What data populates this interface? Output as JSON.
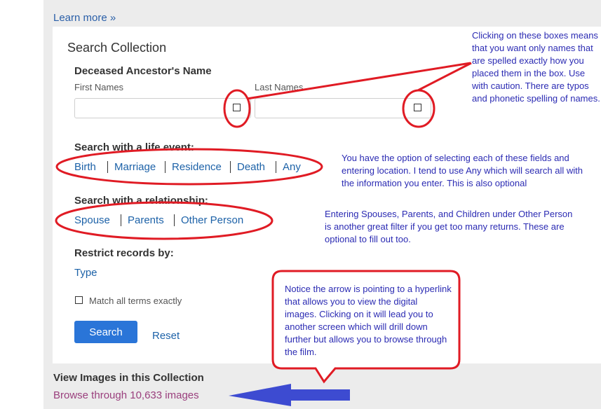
{
  "top": {
    "learn_more": "Learn more »"
  },
  "search": {
    "title": "Search Collection",
    "name_heading": "Deceased Ancestor's Name",
    "first_names_label": "First Names",
    "last_names_label": "Last Names",
    "life_event_heading": "Search with a life event:",
    "life_events": [
      "Birth",
      "Marriage",
      "Residence",
      "Death",
      "Any"
    ],
    "relationship_heading": "Search with a relationship:",
    "relationships": [
      "Spouse",
      "Parents",
      "Other Person"
    ],
    "restrict_heading": "Restrict records by:",
    "type_link": "Type",
    "match_label": "Match all terms exactly",
    "search_button": "Search",
    "reset_link": "Reset"
  },
  "images": {
    "heading": "View Images in this Collection",
    "browse_link": "Browse through 10,633 images"
  },
  "annotations": {
    "exact_boxes": "Clicking on these boxes means that you want only names that are spelled exactly how you placed them in the box. Use with caution. There are typos and phonetic spelling of names.",
    "life_event": "You have the option of selecting each of these fields and entering location. I tend to use Any which will search all with the information you enter. This is also optional",
    "relationship": "Entering Spouses, Parents, and Children under Other Person is another great filter if you get too many returns. These are optional to fill out too.",
    "arrow": "Notice the arrow is pointing to a hyperlink that allows you to view the digital images. Clicking on it will lead you to another screen which will drill down further but allows you to browse through the film."
  },
  "colors": {
    "annotation_red": "#e01b24",
    "annotation_blue": "#3d4bd1",
    "annotation_text": "#2b2bb3",
    "button_blue": "#2a75d8",
    "link_blue": "#1d62a8",
    "browse_link": "#9a3f7d"
  }
}
